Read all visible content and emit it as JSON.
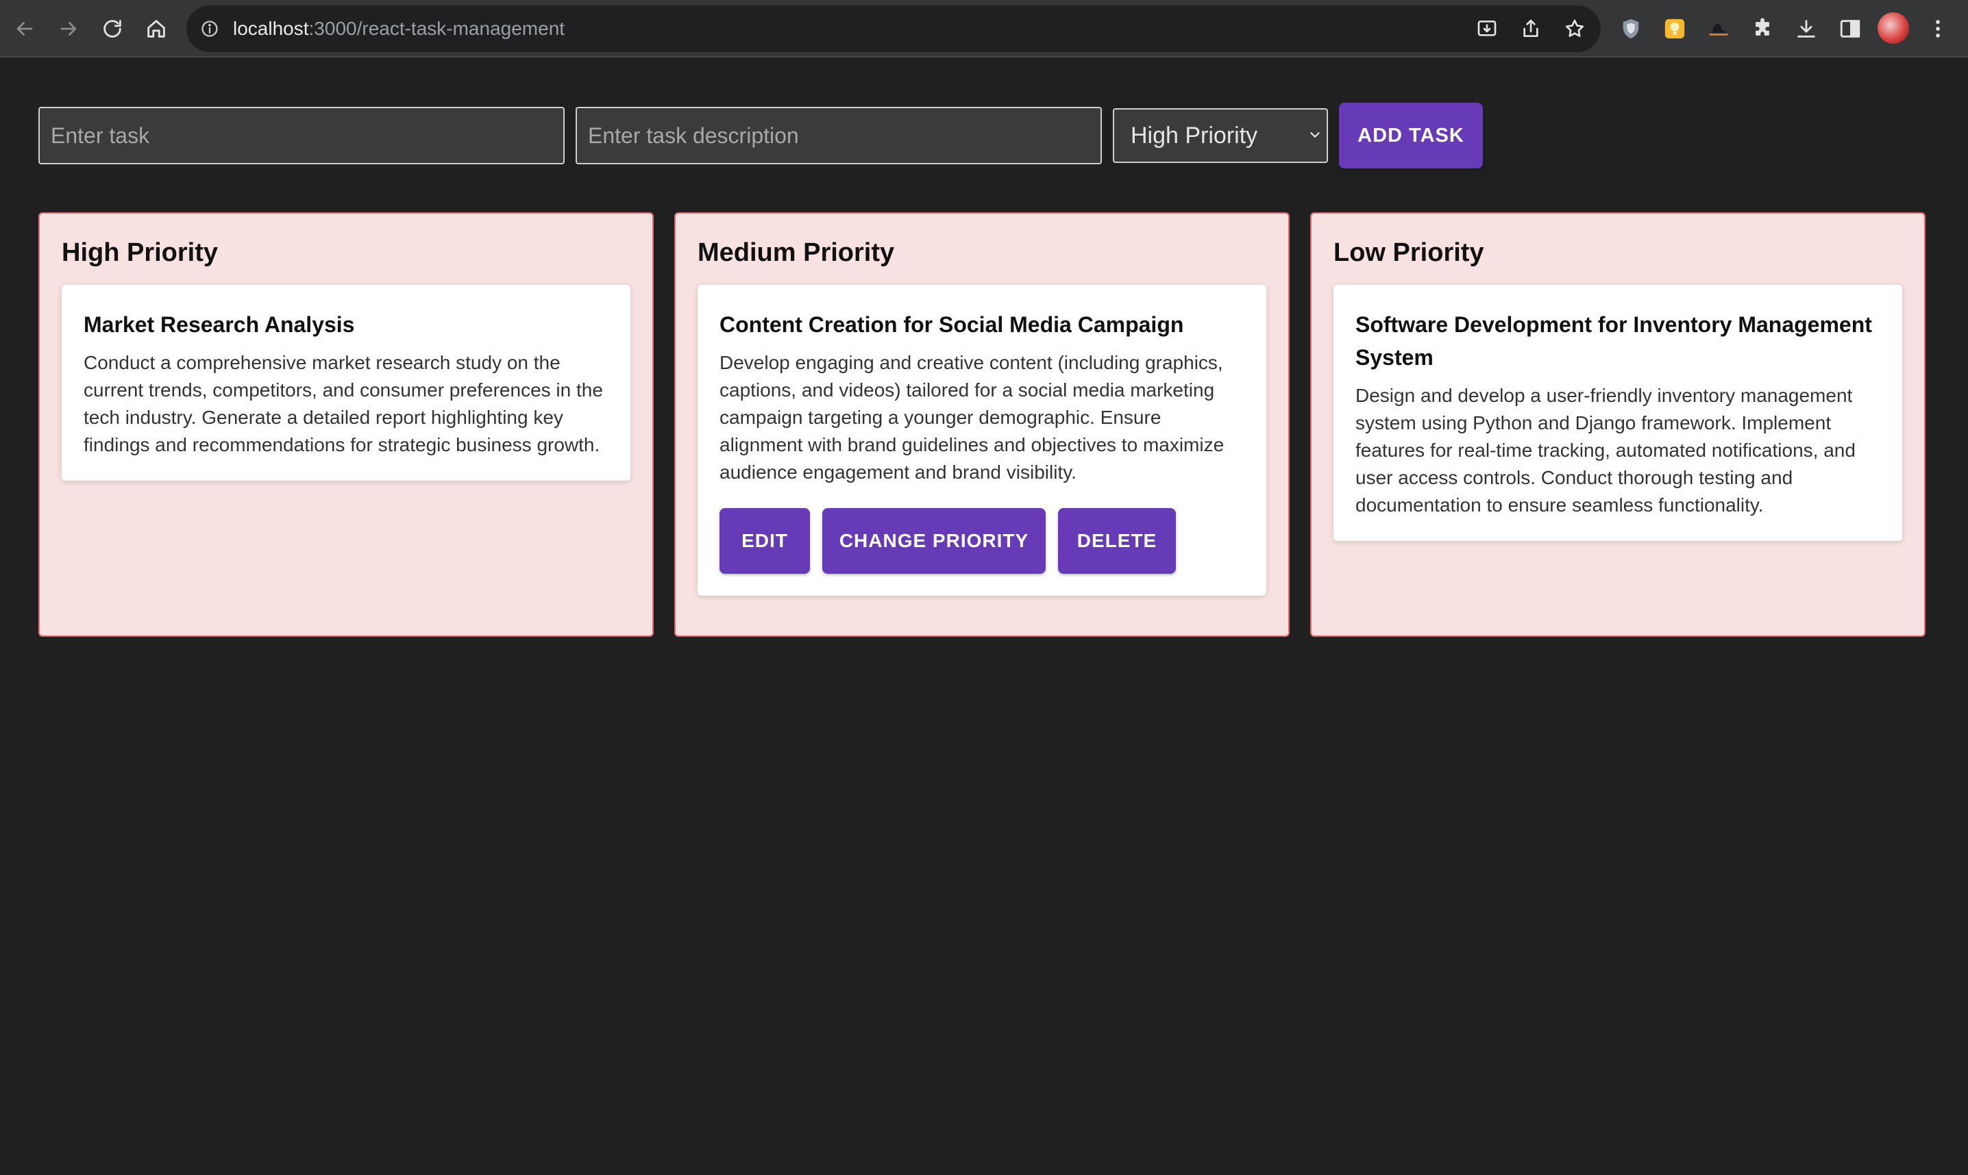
{
  "browser": {
    "url_host": "localhost",
    "url_path": ":3000/react-task-management"
  },
  "form": {
    "task_placeholder": "Enter task",
    "description_placeholder": "Enter task description",
    "priority_selected": "High Priority",
    "add_button_label": "ADD TASK"
  },
  "columns": [
    {
      "title": "High Priority",
      "tasks": [
        {
          "title": "Market Research Analysis",
          "description": "Conduct a comprehensive market research study on the current trends, competitors, and consumer preferences in the tech industry. Generate a detailed report highlighting key findings and recommendations for strategic business growth."
        }
      ]
    },
    {
      "title": "Medium Priority",
      "tasks": [
        {
          "title": "Content Creation for Social Media Campaign",
          "description": "Develop engaging and creative content (including graphics, captions, and videos) tailored for a social media marketing campaign targeting a younger demographic. Ensure alignment with brand guidelines and objectives to maximize audience engagement and brand visibility.",
          "actions": {
            "edit_label": "EDIT",
            "change_priority_label": "CHANGE PRIORITY",
            "delete_label": "DELETE"
          }
        }
      ]
    },
    {
      "title": "Low Priority",
      "tasks": [
        {
          "title": "Software Development for Inventory Management System",
          "description": "Design and develop a user-friendly inventory management system using Python and Django framework. Implement features for real-time tracking, automated notifications, and user access controls. Conduct thorough testing and documentation to ensure seamless functionality."
        }
      ]
    }
  ],
  "colors": {
    "accent": "#673ab7",
    "column_background": "#f8e1e1",
    "column_border": "#e06a6a",
    "page_background": "#202020"
  },
  "icons": {
    "back": "arrow-left-icon",
    "forward": "arrow-right-icon",
    "reload": "reload-icon",
    "home": "home-icon",
    "site_info": "info-icon",
    "install": "install-icon",
    "share": "share-icon",
    "bookmark": "star-icon",
    "extensions": "puzzle-icon",
    "downloads": "download-icon",
    "side_panel": "side-panel-icon",
    "menu": "kebab-menu-icon"
  }
}
